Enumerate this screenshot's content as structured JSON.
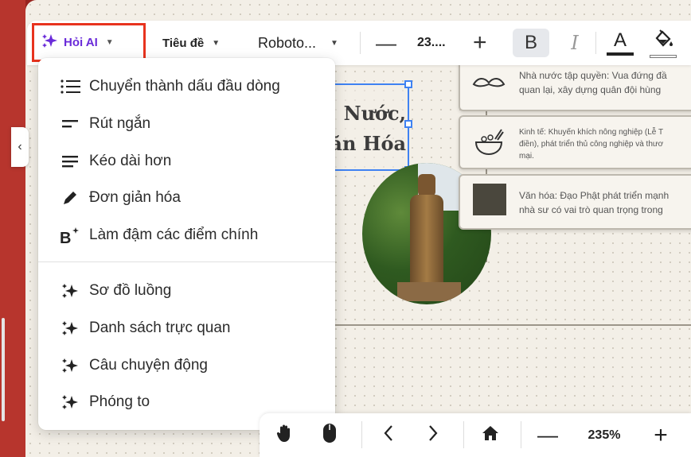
{
  "toolbar": {
    "ai_label": "Hỏi AI",
    "heading_label": "Tiêu đề",
    "font_label": "Roboto...",
    "font_size": "23....",
    "bold_label": "B",
    "italic_label": "I",
    "text_color_label": "A",
    "text_color": "#222222",
    "accent_color": "#6a2bd9",
    "highlight_border_color": "#e8331e"
  },
  "menu": {
    "items": [
      {
        "label": "Chuyển thành dấu đầu dòng",
        "icon": "bullet-list-icon"
      },
      {
        "label": "Rút ngắn",
        "icon": "shorten-icon"
      },
      {
        "label": "Kéo dài hơn",
        "icon": "lengthen-icon"
      },
      {
        "label": "Đơn giản hóa",
        "icon": "pencil-icon"
      },
      {
        "label": "Làm đậm các điểm chính",
        "icon": "bold-sparkle-icon"
      },
      {
        "label": "Sơ đồ luồng",
        "icon": "sparkle-icon"
      },
      {
        "label": "Danh sách trực quan",
        "icon": "sparkle-icon"
      },
      {
        "label": "Câu chuyện động",
        "icon": "sparkle-icon"
      },
      {
        "label": "Phóng to",
        "icon": "sparkle-icon"
      }
    ]
  },
  "slide": {
    "title_line1": "Nước,",
    "title_line2": "ăn Hóa",
    "cards": [
      {
        "text1": "Nhà nước tập quyền: Vua đứng đầ",
        "text2": "quan lại, xây dựng quân đội hùng",
        "icon": "mustache-icon"
      },
      {
        "text1": "Kinh tế: Khuyến khích nông nghiệp (Lễ T",
        "text2": "điền), phát triển thủ công nghiệp và thươ",
        "text3": "mại.",
        "icon": "rice-bowl-icon"
      },
      {
        "text1": "Văn hóa: Đạo Phật phát triển mạnh",
        "text2": "nhà sư có vai trò quan trọng trong",
        "icon": "dark-square"
      }
    ]
  },
  "bottom": {
    "zoom": "235%"
  }
}
